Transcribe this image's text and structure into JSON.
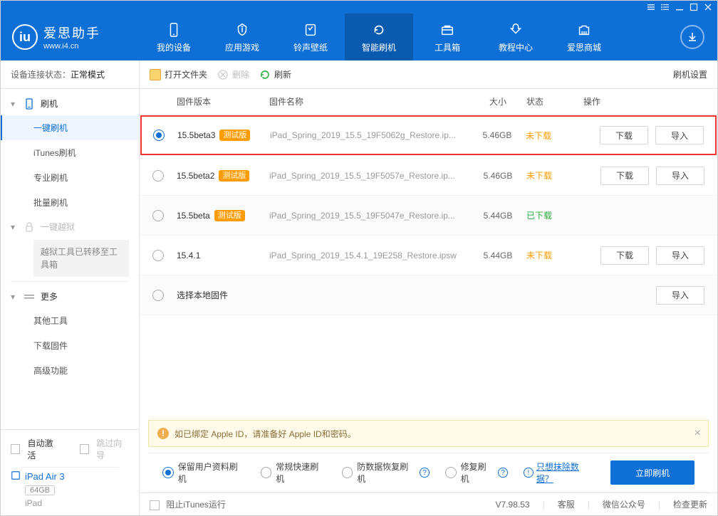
{
  "titlebar": {},
  "logo": {
    "name": "爱思助手",
    "url": "www.i4.cn"
  },
  "nav": [
    {
      "label": "我的设备"
    },
    {
      "label": "应用游戏"
    },
    {
      "label": "铃声壁纸"
    },
    {
      "label": "智能刷机",
      "active": true
    },
    {
      "label": "工具箱"
    },
    {
      "label": "教程中心"
    },
    {
      "label": "爱思商城"
    }
  ],
  "conn": {
    "label": "设备连接状态：",
    "value": "正常模式"
  },
  "sidebar": {
    "flash": {
      "header": "刷机",
      "items": [
        "一键刷机",
        "iTunes刷机",
        "专业刷机",
        "批量刷机"
      ]
    },
    "jailbreak": {
      "header": "一键越狱",
      "note": "越狱工具已转移至工具箱"
    },
    "more": {
      "header": "更多",
      "items": [
        "其他工具",
        "下载固件",
        "高级功能"
      ]
    }
  },
  "side_bottom": {
    "auto_activate": "自动激活",
    "skip_guide": "跳过向导",
    "device_name": "iPad Air 3",
    "storage": "64GB",
    "device_type": "iPad"
  },
  "toolbar": {
    "open_folder": "打开文件夹",
    "delete": "删除",
    "refresh": "刷新",
    "settings": "刷机设置"
  },
  "columns": {
    "version": "固件版本",
    "name": "固件名称",
    "size": "大小",
    "status": "状态",
    "ops": "操作"
  },
  "rows": [
    {
      "selected": true,
      "highlight": true,
      "version": "15.5beta3",
      "beta": "测试版",
      "name": "iPad_Spring_2019_15.5_19F5062g_Restore.ip...",
      "size": "5.46GB",
      "status": "未下载",
      "status_key": "not",
      "download": true,
      "import": true
    },
    {
      "selected": false,
      "highlight": false,
      "version": "15.5beta2",
      "beta": "测试版",
      "name": "iPad_Spring_2019_15.5_19F5057e_Restore.ip...",
      "size": "5.46GB",
      "status": "未下载",
      "status_key": "not",
      "download": true,
      "import": true
    },
    {
      "selected": false,
      "highlight": false,
      "alt": true,
      "version": "15.5beta",
      "beta": "测试版",
      "name": "iPad_Spring_2019_15.5_19F5047e_Restore.ip...",
      "size": "5.44GB",
      "status": "已下载",
      "status_key": "done",
      "download": false,
      "import": false
    },
    {
      "selected": false,
      "highlight": false,
      "version": "15.4.1",
      "beta": null,
      "name": "iPad_Spring_2019_15.4.1_19E258_Restore.ipsw",
      "size": "5.44GB",
      "status": "未下载",
      "status_key": "not",
      "download": true,
      "import": true
    },
    {
      "selected": false,
      "highlight": false,
      "alt": true,
      "local": true,
      "version": "选择本地固件",
      "download": false,
      "import": true
    }
  ],
  "buttons": {
    "download": "下载",
    "import": "导入"
  },
  "notice": "如已绑定 Apple ID，请准备好 Apple ID和密码。",
  "flash_options": [
    {
      "label": "保留用户资料刷机",
      "selected": true
    },
    {
      "label": "常规快速刷机",
      "selected": false
    },
    {
      "label": "防数据恢复刷机",
      "selected": false,
      "help": true
    },
    {
      "label": "修复刷机",
      "selected": false,
      "help": true
    }
  ],
  "erase_link": "只想抹除数据？",
  "flash_button": "立即刷机",
  "statusbar": {
    "block_itunes": "阻止iTunes运行",
    "version": "V7.98.53",
    "items": [
      "客服",
      "微信公众号",
      "检查更新"
    ]
  }
}
